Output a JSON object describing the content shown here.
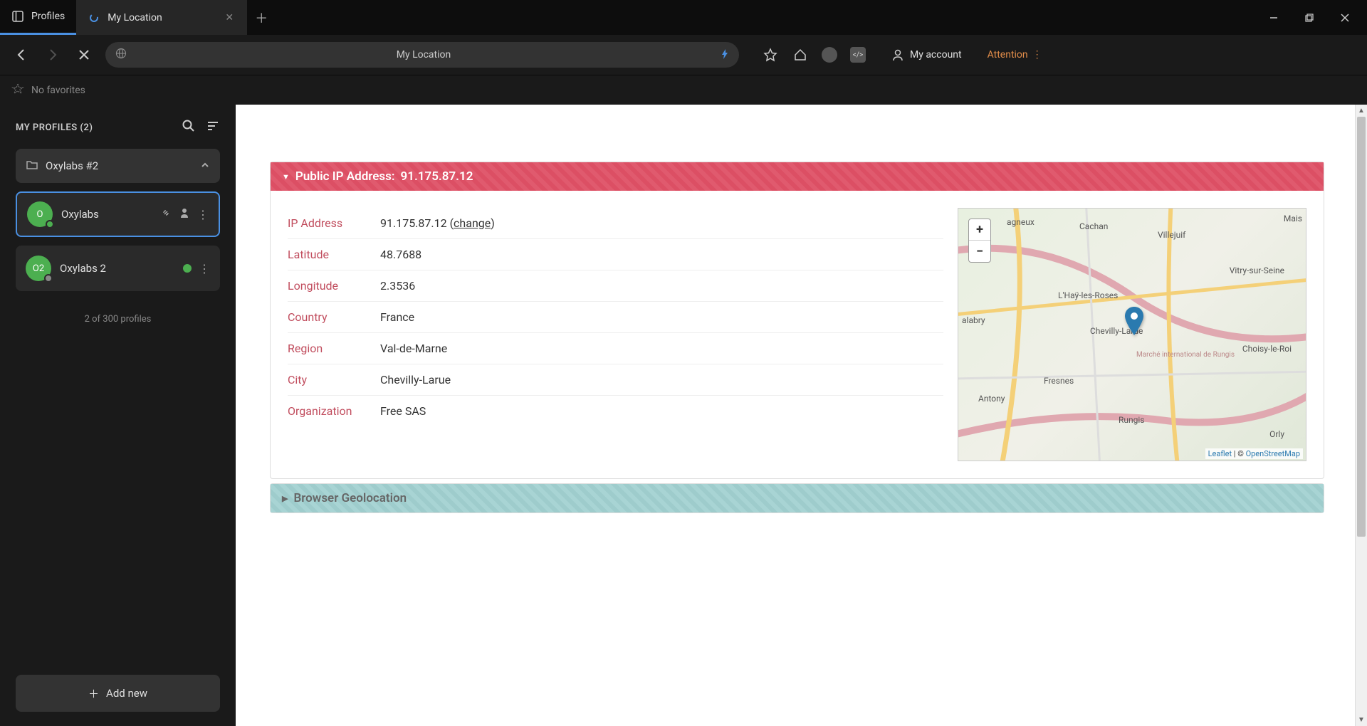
{
  "titlebar": {
    "tab_profiles": "Profiles",
    "tab_page": "My Location"
  },
  "toolbar": {
    "url_text": "My Location",
    "account_label": "My account",
    "attention_label": "Attention"
  },
  "favorites": {
    "empty_label": "No favorites"
  },
  "sidebar": {
    "title": "MY PROFILES (2)",
    "folder": {
      "name": "Oxylabs #2"
    },
    "profiles": [
      {
        "initials": "O",
        "name": "Oxylabs",
        "active": true
      },
      {
        "initials": "O2",
        "name": "Oxylabs 2",
        "active": false
      }
    ],
    "count_text": "2 of 300 profiles",
    "add_new_label": "Add new"
  },
  "content": {
    "ip_panel": {
      "header_label": "Public IP Address:",
      "header_ip": "91.175.87.12",
      "rows": {
        "ip_label": "IP Address",
        "ip_value": "91.175.87.12",
        "change_label": "change",
        "lat_label": "Latitude",
        "lat_value": "48.7688",
        "lon_label": "Longitude",
        "lon_value": "2.3536",
        "country_label": "Country",
        "country_value": "France",
        "region_label": "Region",
        "region_value": "Val-de-Marne",
        "city_label": "City",
        "city_value": "Chevilly-Larue",
        "org_label": "Organization",
        "org_value": "Free SAS"
      }
    },
    "geo_panel": {
      "header_label": "Browser Geolocation"
    },
    "map": {
      "attrib_leaflet": "Leaflet",
      "attrib_osm": "OpenStreetMap",
      "places": {
        "cachan": "Cachan",
        "villejuif": "Villejuif",
        "vitry": "Vitry-sur-Seine",
        "lhay": "L'Haÿ-les-Roses",
        "chevilly": "Chevilly-Larue",
        "fresnes": "Fresnes",
        "antony": "Antony",
        "rungis": "Rungis",
        "orly": "Orly",
        "choisy": "Choisy-le-Roi",
        "alabry": "alabry",
        "mais": "Mais",
        "agneux": "agneux",
        "rungis_market": "Marché international de Rungis"
      }
    }
  }
}
